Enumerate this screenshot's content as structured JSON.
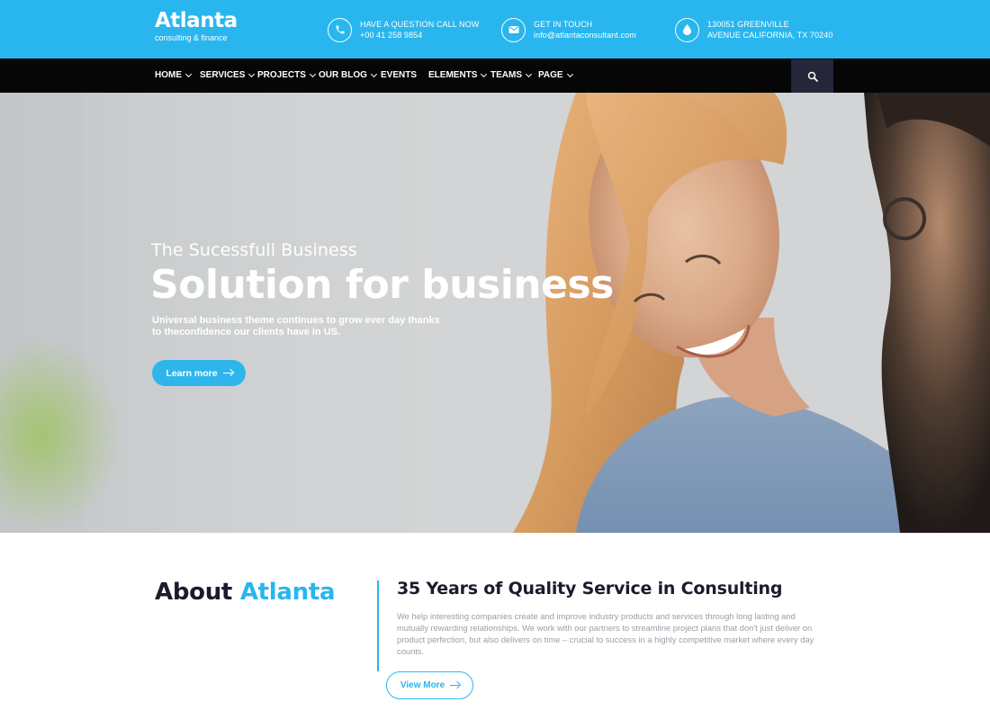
{
  "brand": {
    "name": "Atlanta",
    "tagline": "consulting & finance"
  },
  "contacts": [
    {
      "icon": "phone-icon",
      "line1": "HAVE A QUESTION CALL NOW",
      "line2": "+00 41 258 9854"
    },
    {
      "icon": "mail-icon",
      "line1": "GET IN TOUCH",
      "line2": "info@atlantaconsultant.com"
    },
    {
      "icon": "location-drop-icon",
      "line1": "130051 GREENVILLE",
      "line2": "AVENUE CALIFORNIA, TX 70240"
    }
  ],
  "nav": {
    "items": [
      {
        "label": "HOME",
        "dropdown": true
      },
      {
        "label": "SERVICES",
        "dropdown": true
      },
      {
        "label": "PROJECTS",
        "dropdown": true
      },
      {
        "label": "OUR BLOG",
        "dropdown": true
      },
      {
        "label": "EVENTS",
        "dropdown": false
      },
      {
        "label": "ELEMENTS",
        "dropdown": true
      },
      {
        "label": "TEAMS",
        "dropdown": true
      },
      {
        "label": "PAGE",
        "dropdown": true
      }
    ],
    "search_icon": "search-icon"
  },
  "hero": {
    "overline": "The Sucessfull Business",
    "title": "Solution for business",
    "description": "Universal business theme continues to grow ever day thanks to theconfidence our clients have in US.",
    "button_label": "Learn more"
  },
  "about": {
    "heading_prefix": "About",
    "heading_accent": "Atlanta",
    "subheading": "35 Years of Quality Service in Consulting",
    "text": "We help interesting companies create and improve industry products and services through long lasting and mutually rewarding relationships. We work with our partners to streamline project plans that don't just deliver on product perfection, but also delivers on time – crucial to success in a highly competitive market where every day counts.",
    "button_label": "View More"
  },
  "colors": {
    "brand_blue": "#29b6ee",
    "nav_bg": "#060606",
    "search_bg": "#25263a",
    "heading_dark": "#1b1b2b"
  }
}
